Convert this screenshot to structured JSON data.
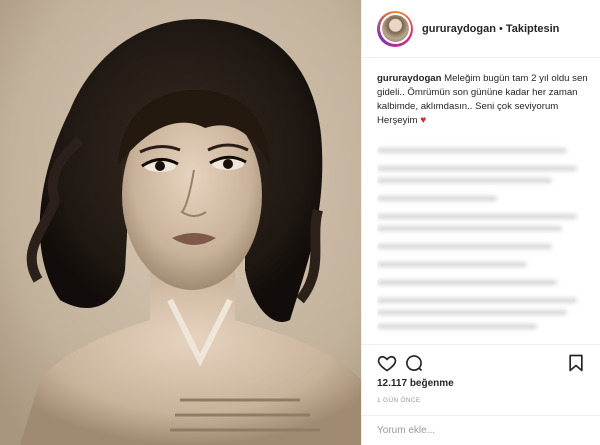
{
  "header": {
    "username": "gururaydogan",
    "separator": "•",
    "follow_label": "Takiptesin"
  },
  "caption": {
    "username": "gururaydogan",
    "text": "Meleğim bugün tam 2 yıl oldu sen gideli.. Ömrümün son gününe kadar her zaman kalbimde, aklımdasın.. Seni çok seviyorum Herşeyim",
    "emoji": "♥"
  },
  "actions": {
    "like_icon": "heart-icon",
    "comment_icon": "comment-icon",
    "save_icon": "bookmark-icon"
  },
  "likes": "12.117 beğenme",
  "timestamp": "1 GÜN ÖNCE",
  "comment_input": {
    "placeholder": "Yorum ekle..."
  },
  "colors": {
    "accent_heart": "#d8262d",
    "muted": "#999999",
    "divider": "#efefef"
  }
}
